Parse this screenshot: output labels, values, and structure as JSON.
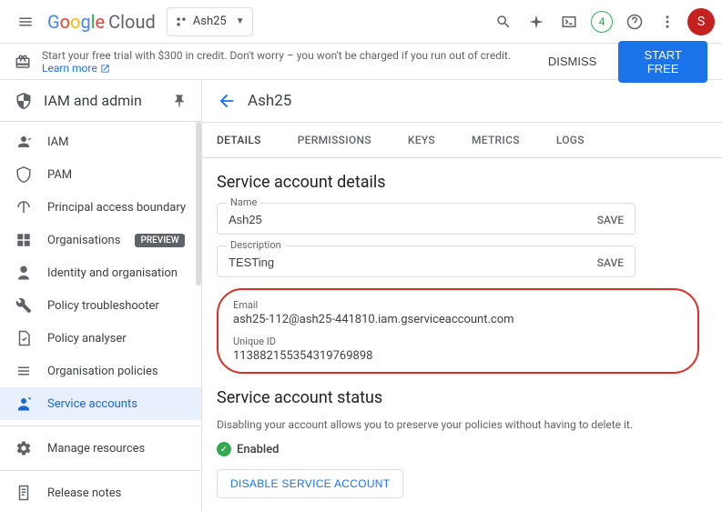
{
  "header": {
    "logo_cloud": "Cloud",
    "project_name": "Ash25",
    "notification_count": "4",
    "avatar_letter": "S"
  },
  "trial": {
    "text_prefix": "Start your free trial with $300 in credit. Don't worry – you won't be charged if you run out of credit. ",
    "link_text": "Learn more",
    "dismiss": "DISMISS",
    "start_free": "START FREE"
  },
  "sidebar": {
    "title": "IAM and admin",
    "items": [
      {
        "label": "IAM"
      },
      {
        "label": "PAM"
      },
      {
        "label": "Principal access boundary"
      },
      {
        "label": "Organisations",
        "badge": "PREVIEW"
      },
      {
        "label": "Identity and organisation"
      },
      {
        "label": "Policy troubleshooter"
      },
      {
        "label": "Policy analyser"
      },
      {
        "label": "Organisation policies"
      },
      {
        "label": "Service accounts"
      },
      {
        "label": "Manage resources"
      },
      {
        "label": "Release notes"
      }
    ]
  },
  "content": {
    "title": "Ash25",
    "tabs": [
      {
        "label": "DETAILS"
      },
      {
        "label": "PERMISSIONS"
      },
      {
        "label": "KEYS"
      },
      {
        "label": "METRICS"
      },
      {
        "label": "LOGS"
      }
    ],
    "details": {
      "section_title": "Service account details",
      "name_label": "Name",
      "name_value": "Ash25",
      "desc_label": "Description",
      "desc_value": "TESTing",
      "save": "SAVE",
      "email_label": "Email",
      "email_value": "ash25-112@ash25-441810.iam.gserviceaccount.com",
      "uid_label": "Unique ID",
      "uid_value": "113882155354319769898"
    },
    "status": {
      "section_title": "Service account status",
      "description": "Disabling your account allows you to preserve your policies without having to delete it.",
      "enabled_label": "Enabled",
      "disable_button": "DISABLE SERVICE ACCOUNT"
    }
  }
}
